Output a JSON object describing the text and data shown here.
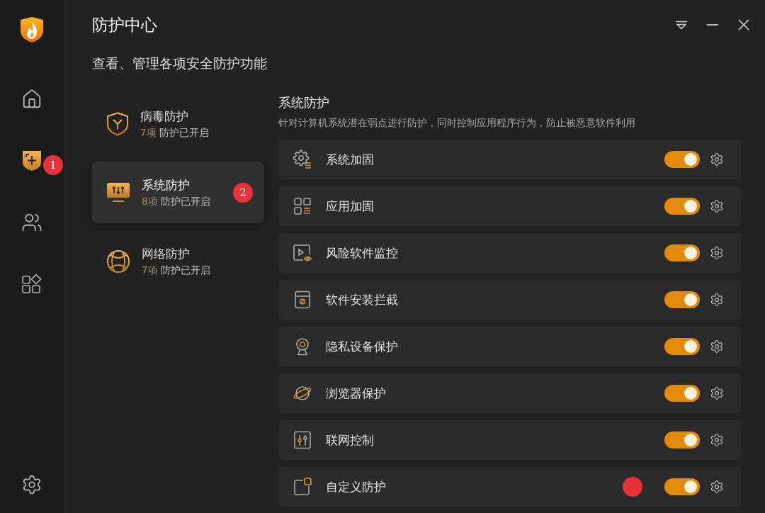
{
  "window": {
    "title": "防护中心",
    "subtitle": "查看、管理各项安全防护功能"
  },
  "sidebar": {
    "items": [
      {
        "kind": "home",
        "selected": false
      },
      {
        "kind": "shield",
        "selected": true,
        "badge": "1"
      },
      {
        "kind": "users",
        "selected": false
      },
      {
        "kind": "apps",
        "selected": false
      }
    ]
  },
  "categories": [
    {
      "kind": "virus",
      "title": "病毒防护",
      "count": "7项",
      "status": "防护已开启",
      "selected": false
    },
    {
      "kind": "system",
      "title": "系统防护",
      "count": "8项",
      "status": "防护已开启",
      "selected": true,
      "badge": "2"
    },
    {
      "kind": "network",
      "title": "网络防护",
      "count": "7项",
      "status": "防护已开启",
      "selected": false
    }
  ],
  "panel": {
    "title": "系统防护",
    "description": "针对计算机系统潜在弱点进行防护，同时控制应用程序行为，防止被恶意软件利用",
    "rows": [
      {
        "kind": "gear-list",
        "label": "系统加固",
        "on": true,
        "marked": false
      },
      {
        "kind": "grid-list",
        "label": "应用加固",
        "on": true,
        "marked": false
      },
      {
        "kind": "video-eye",
        "label": "风险软件监控",
        "on": true,
        "marked": false
      },
      {
        "kind": "box-block",
        "label": "软件安装拦截",
        "on": true,
        "marked": false
      },
      {
        "kind": "webcam",
        "label": "隐私设备保护",
        "on": true,
        "marked": false
      },
      {
        "kind": "planet",
        "label": "浏览器保护",
        "on": true,
        "marked": false
      },
      {
        "kind": "sliders",
        "label": "联网控制",
        "on": true,
        "marked": false
      },
      {
        "kind": "window-corner",
        "label": "自定义防护",
        "on": true,
        "marked": true
      }
    ]
  }
}
